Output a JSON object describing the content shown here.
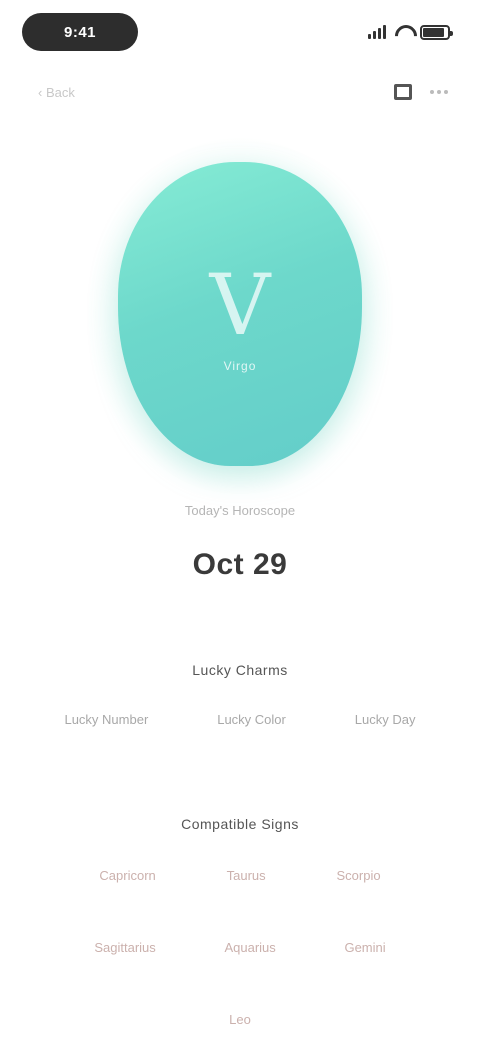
{
  "status_bar": {
    "time": "9:41"
  },
  "nav": {
    "back_label": "‹ Back",
    "book_icon": "book-icon",
    "more_icon": "more-icon"
  },
  "orb": {
    "letter": "V",
    "caption": "Virgo",
    "color_top": "#86ecd5",
    "color_bottom": "#63cdc9"
  },
  "header": {
    "day_label": "Today's Horoscope",
    "date": "Oct 29"
  },
  "sections": [
    {
      "title": "Lucky Charms",
      "rows": [
        [
          "Lucky Number",
          "Lucky Color",
          "Lucky Day"
        ]
      ]
    },
    {
      "title": "Compatible Signs",
      "rows": [
        [
          "Capricorn",
          "Taurus",
          "Scorpio"
        ],
        [
          "Sagittarius",
          "Aquarius",
          "Gemini"
        ],
        [
          "Leo"
        ]
      ]
    }
  ]
}
